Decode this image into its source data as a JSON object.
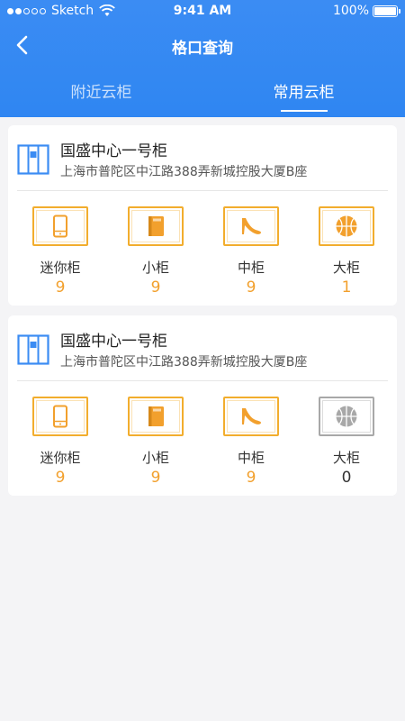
{
  "status_bar": {
    "carrier": "Sketch",
    "time": "9:41 AM",
    "battery": "100%"
  },
  "nav": {
    "title": "格口查询"
  },
  "tabs": [
    {
      "label": "附近云柜",
      "active": false
    },
    {
      "label": "常用云柜",
      "active": true
    }
  ],
  "lockers": [
    {
      "name": "国盛中心一号柜",
      "address": "上海市普陀区中江路388弄新城控股大厦B座",
      "slots": [
        {
          "label": "迷你柜",
          "count": "9",
          "icon": "phone-icon"
        },
        {
          "label": "小柜",
          "count": "9",
          "icon": "book-icon"
        },
        {
          "label": "中柜",
          "count": "9",
          "icon": "high-heel-icon"
        },
        {
          "label": "大柜",
          "count": "1",
          "icon": "basketball-icon"
        }
      ]
    },
    {
      "name": "国盛中心一号柜",
      "address": "上海市普陀区中江路388弄新城控股大厦B座",
      "slots": [
        {
          "label": "迷你柜",
          "count": "9",
          "icon": "phone-icon"
        },
        {
          "label": "小柜",
          "count": "9",
          "icon": "book-icon"
        },
        {
          "label": "中柜",
          "count": "9",
          "icon": "high-heel-icon"
        },
        {
          "label": "大柜",
          "count": "0",
          "icon": "basketball-icon"
        }
      ]
    }
  ],
  "colors": {
    "header": "#2f86f2",
    "accent": "#f2a02d",
    "disabled": "#a8a8a8"
  }
}
